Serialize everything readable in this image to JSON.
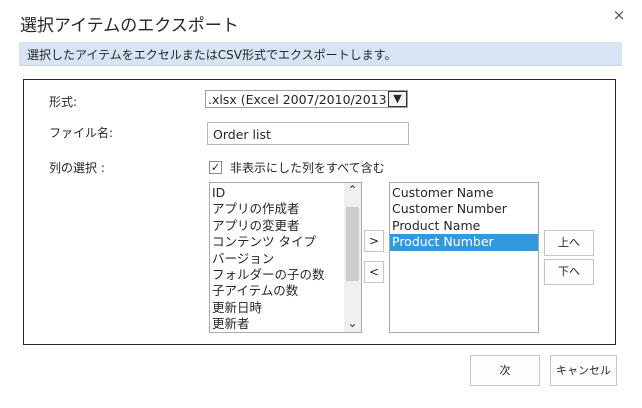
{
  "dialog": {
    "title": "選択アイテムのエクスポート",
    "close_glyph": "×",
    "banner": "選択したアイテムをエクセルまたはCSV形式でエクスポートします。"
  },
  "form": {
    "format_label": "形式:",
    "format_value": ".xlsx (Excel 2007/2010/2013)",
    "format_dropdown_glyph": "▼",
    "filename_label": "ファイル名:",
    "filename_value": "Order list",
    "columns_label": "列の選択 :",
    "include_hidden_label": "非表示にした列をすべて含む",
    "include_hidden_checked": true,
    "checkmark_glyph": "✓"
  },
  "available_columns": {
    "items": [
      "ID",
      "アプリの作成者",
      "アプリの変更者",
      "コンテンツ タイプ",
      "バージョン",
      "フォルダーの子の数",
      "子アイテムの数",
      "更新日時",
      "更新者"
    ],
    "scroll_up_glyph": "⌃",
    "scroll_down_glyph": "⌄"
  },
  "selected_columns": {
    "items": [
      "Customer Name",
      "Customer Number",
      "Product Name",
      "Product Number"
    ],
    "highlighted_index": 3
  },
  "buttons": {
    "add": ">",
    "remove": "<",
    "move_up": "上へ",
    "move_down": "下へ",
    "next": "次",
    "cancel": "キャンセル"
  },
  "colors": {
    "banner_bg": "#d7e4f3",
    "selection": "#3399dd"
  }
}
